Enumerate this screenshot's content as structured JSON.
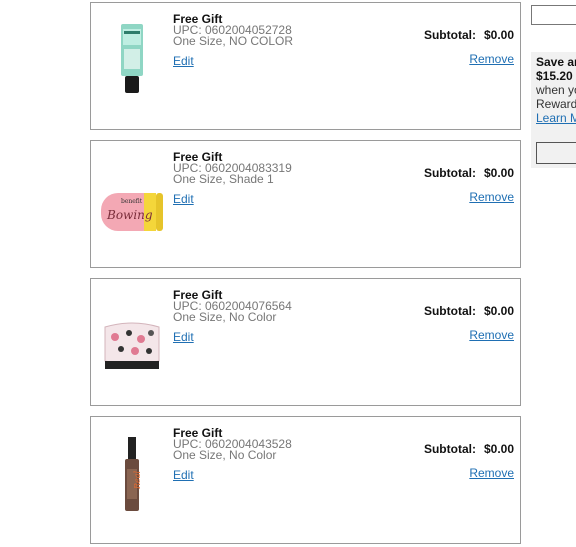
{
  "items": [
    {
      "title": "Free Gift",
      "upc": "UPC: 0602004052728",
      "variant": "One Size, NO COLOR",
      "edit_label": "Edit",
      "subtotal_label": "Subtotal:",
      "subtotal_value": "$0.00",
      "remove_label": "Remove",
      "thumb_icon": "primer-tube-product-image"
    },
    {
      "title": "Free Gift",
      "upc": "UPC: 0602004083319",
      "variant": "One Size, Shade 1",
      "edit_label": "Edit",
      "subtotal_label": "Subtotal:",
      "subtotal_value": "$0.00",
      "remove_label": "Remove",
      "thumb_icon": "brow-wax-compact-product-image"
    },
    {
      "title": "Free Gift",
      "upc": "UPC: 0602004076564",
      "variant": "One Size, No Color",
      "edit_label": "Edit",
      "subtotal_label": "Subtotal:",
      "subtotal_value": "$0.00",
      "remove_label": "Remove",
      "thumb_icon": "cosmetic-bag-product-image"
    },
    {
      "title": "Free Gift",
      "upc": "UPC: 0602004043528",
      "variant": "One Size, No Color",
      "edit_label": "Edit",
      "subtotal_label": "Subtotal:",
      "subtotal_value": "$0.00",
      "remove_label": "Remove",
      "thumb_icon": "mascara-product-image"
    }
  ],
  "promo": {
    "line1": "Save an",
    "line2": "$15.20",
    "line3": "when yo",
    "line4": "Reward",
    "link": "Learn M"
  },
  "colors": {
    "link": "#1f6fb3",
    "border": "#9a9a9a",
    "panel": "#f1f1f1"
  }
}
